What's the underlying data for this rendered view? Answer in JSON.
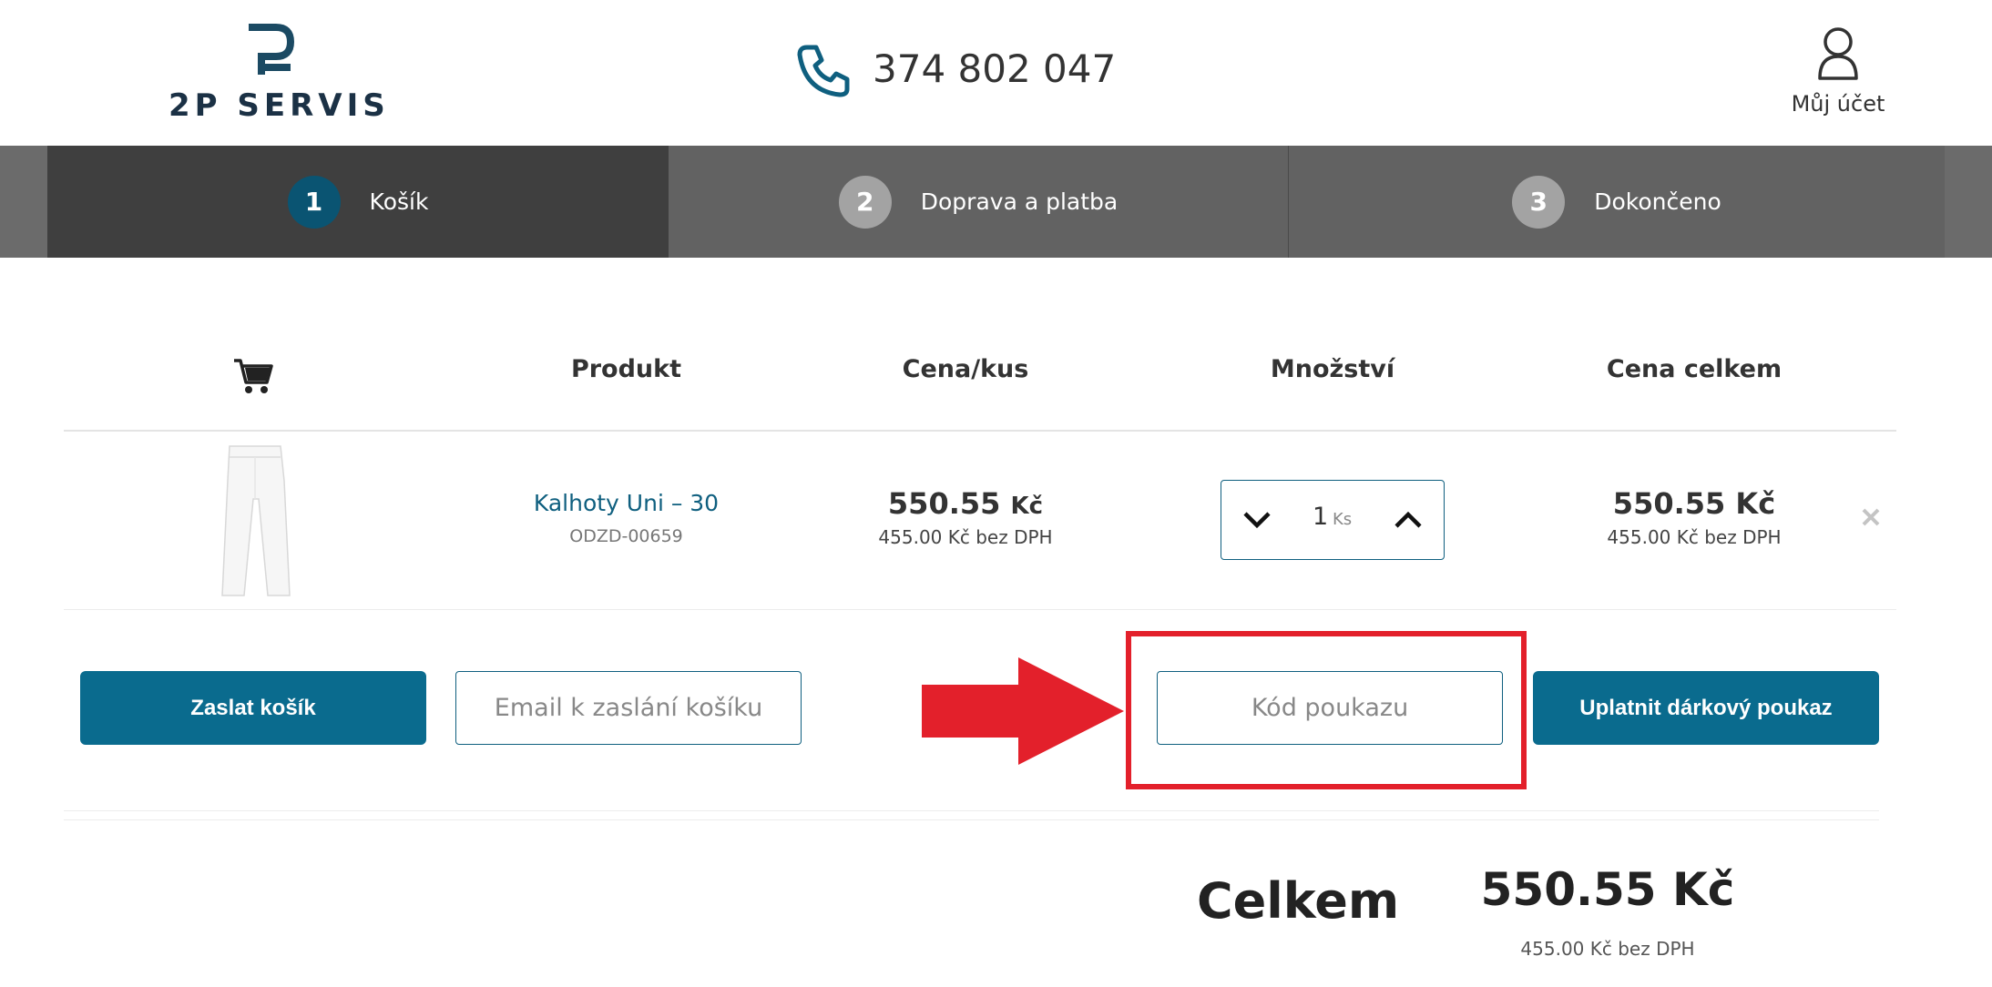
{
  "header": {
    "logo_text": "2P SERVIS",
    "phone": "374 802 047",
    "account_label": "Můj účet"
  },
  "steps": [
    {
      "number": "1",
      "label": "Košík",
      "active": true
    },
    {
      "number": "2",
      "label": "Doprava a platba",
      "active": false
    },
    {
      "number": "3",
      "label": "Dokončeno",
      "active": false
    }
  ],
  "table": {
    "headers": {
      "product": "Produkt",
      "unit_price": "Cena/kus",
      "quantity": "Množství",
      "total_price": "Cena celkem"
    },
    "rows": [
      {
        "name": "Kalhoty Uni – 30",
        "code": "ODZD-00659",
        "unit_price_value": "550.55",
        "unit_price_currency": "Kč",
        "unit_price_excl": "455.00 Kč bez DPH",
        "quantity": "1",
        "quantity_unit": "Ks",
        "total": "550.55 Kč",
        "total_excl": "455.00 Kč bez DPH"
      }
    ]
  },
  "actions": {
    "send_cart_label": "Zaslat košík",
    "email_placeholder": "Email k zaslání košíku",
    "voucher_placeholder": "Kód poukazu",
    "apply_voucher_label": "Uplatnit dárkový poukaz"
  },
  "summary": {
    "label": "Celkem",
    "total": "550.55 Kč",
    "total_excl": "455.00 Kč bez DPH"
  },
  "colors": {
    "brand": "#0a6b8e",
    "highlight": "#e3202b",
    "step_active": "#3f3f3f",
    "step_inactive": "#626262"
  }
}
